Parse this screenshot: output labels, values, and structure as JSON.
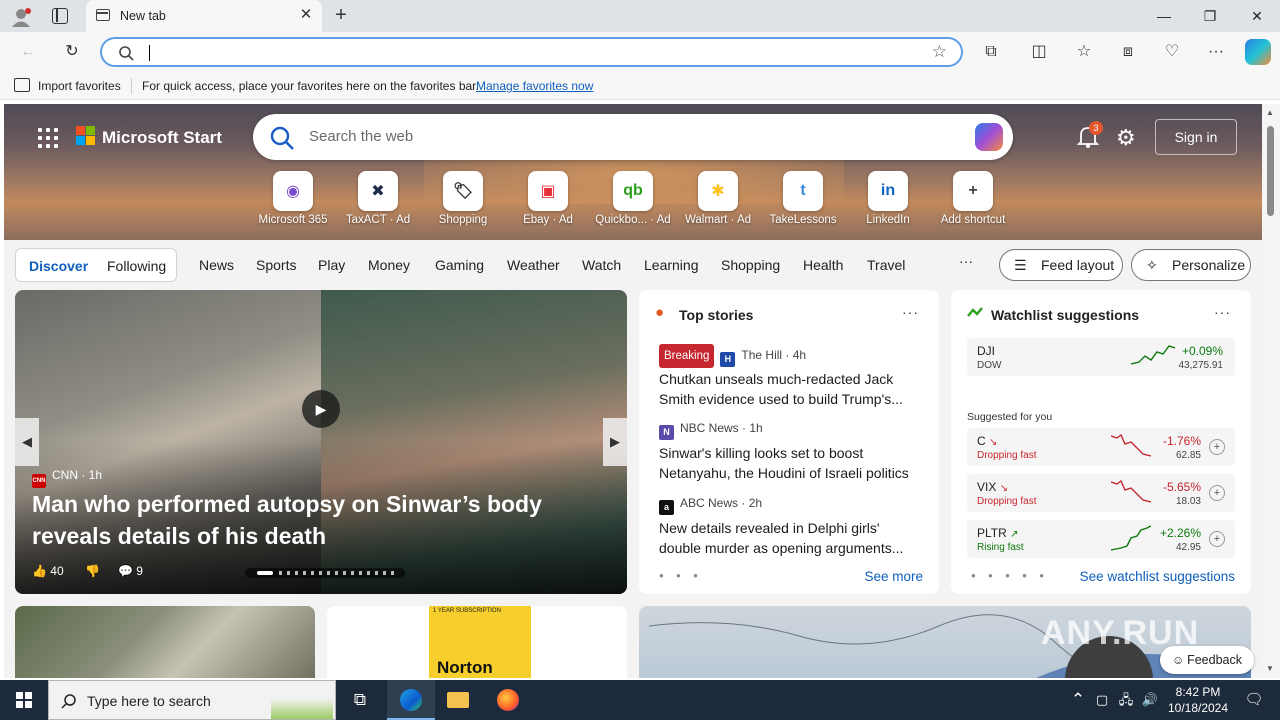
{
  "browser": {
    "tab_title": "New tab",
    "address_value": "",
    "favorites_bar": {
      "import_label": "Import favorites",
      "hint": "For quick access, place your favorites here on the favorites bar.",
      "manage_link": "Manage favorites now"
    }
  },
  "start": {
    "brand": "Microsoft Start",
    "search_placeholder": "Search the web",
    "notification_count": "3",
    "sign_in": "Sign in",
    "shortcuts": [
      {
        "label": "Microsoft 365",
        "icon": "microsoft-365-icon",
        "glyph": "◉",
        "color": "#7a4ccf"
      },
      {
        "label": "TaxACT · Ad",
        "icon": "taxact-icon",
        "glyph": "✖",
        "color": "#1e2a4a"
      },
      {
        "label": "Shopping",
        "icon": "shopping-tag-icon",
        "glyph": "🏷",
        "color": "#333333"
      },
      {
        "label": "Ebay · Ad",
        "icon": "ebay-icon",
        "glyph": "▣",
        "color": "#e53238"
      },
      {
        "label": "Quickbo... · Ad",
        "icon": "quickbooks-icon",
        "glyph": "qb",
        "color": "#2ca01c"
      },
      {
        "label": "Walmart · Ad",
        "icon": "walmart-icon",
        "glyph": "✱",
        "color": "#ffc220"
      },
      {
        "label": "TakeLessons",
        "icon": "takelessons-icon",
        "glyph": "t",
        "color": "#3b8bd1"
      },
      {
        "label": "LinkedIn",
        "icon": "linkedin-icon",
        "glyph": "in",
        "color": "#0a66c2"
      },
      {
        "label": "Add shortcut",
        "icon": "add-icon",
        "glyph": "+",
        "color": "#444444"
      }
    ],
    "tabs": {
      "discover": "Discover",
      "following": "Following"
    },
    "nav_items": [
      "News",
      "Sports",
      "Play",
      "Money",
      "Gaming",
      "Weather",
      "Watch",
      "Learning",
      "Shopping",
      "Health",
      "Travel"
    ],
    "more": "···",
    "feed_layout": "Feed layout",
    "personalize": "Personalize"
  },
  "main_story": {
    "source": "CNN",
    "age": "1h",
    "headline": "Man who performed autopsy on Sinwar’s body reveals details of his death",
    "likes": "40",
    "comments": "9"
  },
  "top_stories": {
    "title": "Top stories",
    "more": "···",
    "items": [
      {
        "badge": "Breaking",
        "source": "The Hill",
        "age": "4h",
        "title": "Chutkan unseals much-redacted Jack Smith evidence used to build Trump's...",
        "icon_color": "#1f4aa8",
        "icon_glyph": "H"
      },
      {
        "badge": "",
        "source": "NBC News",
        "age": "1h",
        "title": "Sinwar's killing looks set to boost Netanyahu, the Houdini of Israeli politics",
        "icon_color": "#5b4aa8",
        "icon_glyph": "N"
      },
      {
        "badge": "",
        "source": "ABC News",
        "age": "2h",
        "title": "New details revealed in Delphi girls' double murder as opening arguments...",
        "icon_color": "#111111",
        "icon_glyph": "a"
      }
    ],
    "see_more": "See more"
  },
  "watchlist": {
    "title": "Watchlist suggestions",
    "more": "···",
    "index": {
      "symbol": "DJI",
      "name": "DOW",
      "change": "+0.09%",
      "price": "43,275.91"
    },
    "suggested_label": "Suggested for you",
    "stocks": [
      {
        "symbol": "C",
        "status": "Dropping fast",
        "change": "-1.76%",
        "price": "62.85",
        "trend": "down"
      },
      {
        "symbol": "VIX",
        "status": "Dropping fast",
        "change": "-5.65%",
        "price": "18.03",
        "trend": "down"
      },
      {
        "symbol": "PLTR",
        "status": "Rising fast",
        "change": "+2.26%",
        "price": "42.95",
        "trend": "up"
      }
    ],
    "see_all": "See watchlist suggestions"
  },
  "bottom_card": {
    "product": "Norton",
    "promo": "1 YEAR SUBSCRIPTION"
  },
  "feedback": "Feedback",
  "taskbar": {
    "search_placeholder": "Type here to search",
    "time": "8:42 PM",
    "date": "10/18/2024"
  },
  "watermark": "ANY.RUN"
}
